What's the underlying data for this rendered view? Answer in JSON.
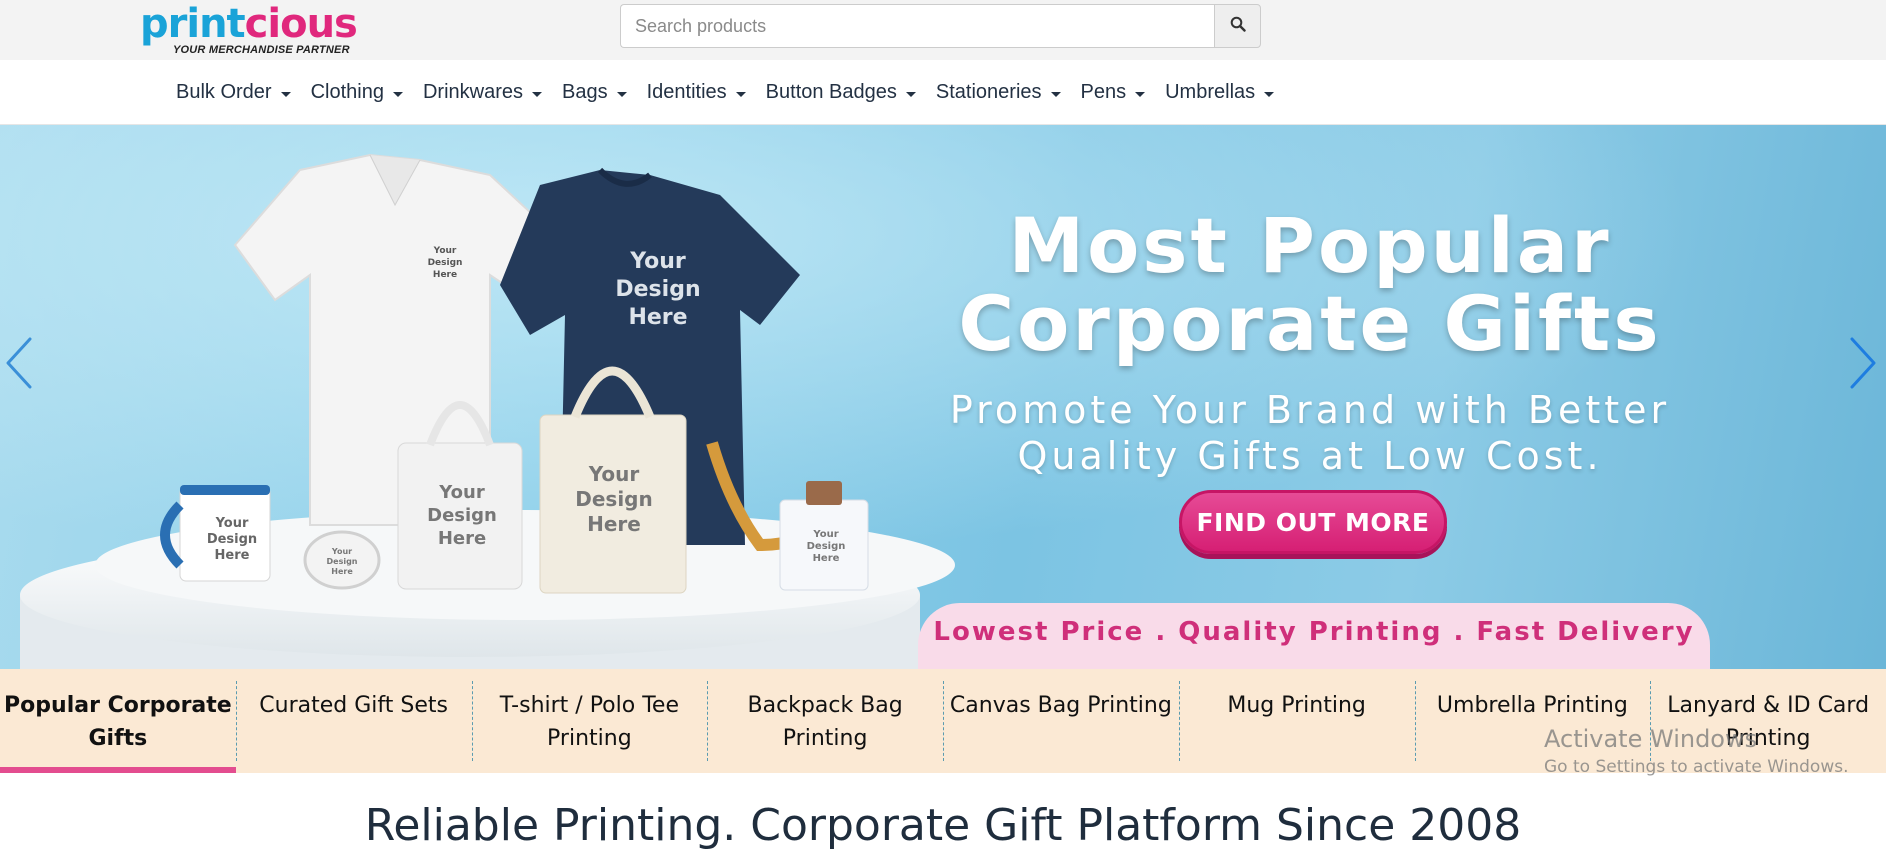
{
  "header": {
    "logo_text_blue": "print",
    "logo_text_pink": "cious",
    "logo_tagline": "YOUR MERCHANDISE PARTNER",
    "search": {
      "placeholder": "Search products",
      "value": ""
    },
    "search_icon": "search-icon"
  },
  "nav": {
    "items": [
      {
        "label": "Bulk Order"
      },
      {
        "label": "Clothing"
      },
      {
        "label": "Drinkwares"
      },
      {
        "label": "Bags"
      },
      {
        "label": "Identities"
      },
      {
        "label": "Button Badges"
      },
      {
        "label": "Stationeries"
      },
      {
        "label": "Pens"
      },
      {
        "label": "Umbrellas"
      }
    ]
  },
  "hero": {
    "title_line1": "Most Popular",
    "title_line2": "Corporate Gifts",
    "subtitle_line1": "Promote Your Brand with Better",
    "subtitle_line2": "Quality Gifts at Low Cost.",
    "cta_label": "FIND OUT MORE",
    "strip_text": "Lowest Price . Quality Printing . Fast Delivery",
    "mockup_text": "Your Design Here",
    "mockup_lines": [
      "Your",
      "Design",
      "Here"
    ],
    "prev_icon": "chevron-left-icon",
    "next_icon": "chevron-right-icon"
  },
  "categories": {
    "items": [
      {
        "label": "Popular Corporate Gifts",
        "active": true
      },
      {
        "label": "Curated Gift Sets",
        "active": false
      },
      {
        "label": "T-shirt / Polo Tee Printing",
        "active": false
      },
      {
        "label": "Backpack Bag Printing",
        "active": false
      },
      {
        "label": "Canvas Bag Printing",
        "active": false
      },
      {
        "label": "Mug Printing",
        "active": false
      },
      {
        "label": "Umbrella Printing",
        "active": false
      },
      {
        "label": "Lanyard & ID Card Printing",
        "active": false
      }
    ]
  },
  "section": {
    "heading": "Reliable Printing. Corporate Gift Platform Since 2008"
  },
  "watermark": {
    "title": "Activate Windows",
    "subtitle": "Go to Settings to activate Windows."
  },
  "colors": {
    "brand_blue": "#1aa3d8",
    "brand_pink": "#e0287d",
    "cta_pink": "#d61f74",
    "category_bar": "#fbe9d4",
    "active_underline": "#e34d8f"
  }
}
